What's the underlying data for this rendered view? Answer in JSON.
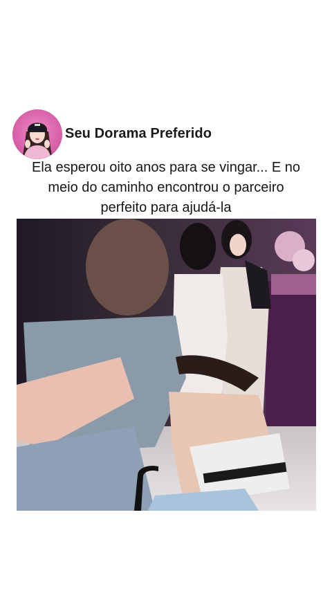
{
  "post": {
    "account_name": "Seu Dorama Preferido",
    "caption_lines": [
      "Ela esperou oito anos para se vingar... E no",
      "meio do caminho encontrou o parceiro",
      "perfeito para ajudá-la"
    ]
  },
  "icons": {
    "avatar": "profile-avatar-icon"
  },
  "colors": {
    "background": "#ffffff",
    "avatar_bg": "#d45ba6",
    "text": "#161616"
  }
}
